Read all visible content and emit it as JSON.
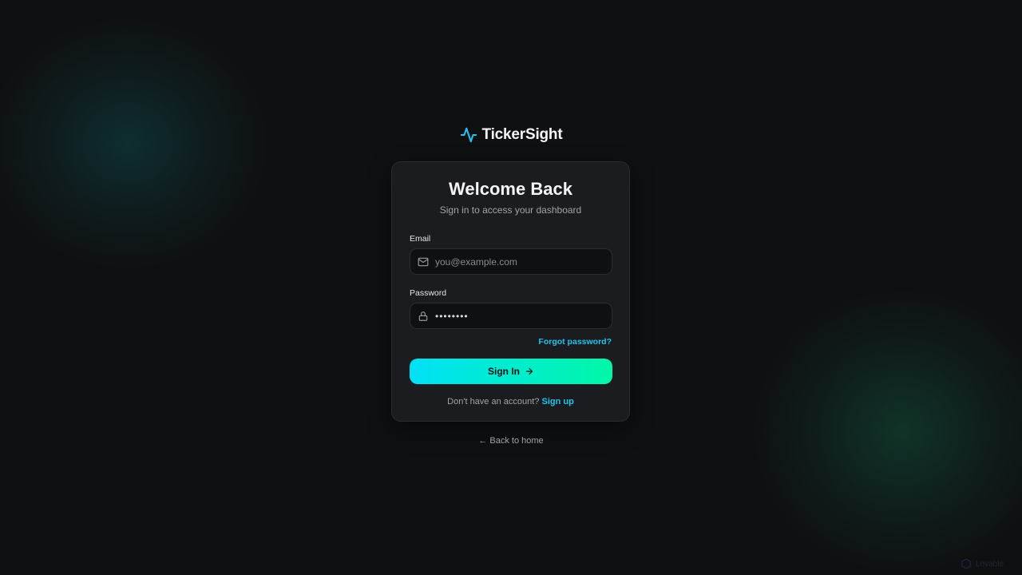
{
  "brand": {
    "name": "TickerSight",
    "icon": "pulse-icon"
  },
  "card": {
    "title": "Welcome Back",
    "subtitle": "Sign in to access your dashboard"
  },
  "form": {
    "email_label": "Email",
    "email_placeholder": "you@example.com",
    "email_value": "",
    "email_icon": "mail-icon",
    "password_label": "Password",
    "password_value": "password",
    "password_icon": "lock-icon",
    "forgot_label": "Forgot password?",
    "submit_label": "Sign In",
    "submit_icon": "arrow-right-icon"
  },
  "signup": {
    "prompt": "Don't have an account?",
    "link_label": "Sign up"
  },
  "back_link": "← Back to home",
  "watermark": {
    "text": "Lovable"
  },
  "colors": {
    "background": "#0f1012",
    "card": "#1b1c1f",
    "accent": "#22c3ec",
    "gradient_start": "#00e1f6",
    "gradient_end": "#00f7a7"
  }
}
